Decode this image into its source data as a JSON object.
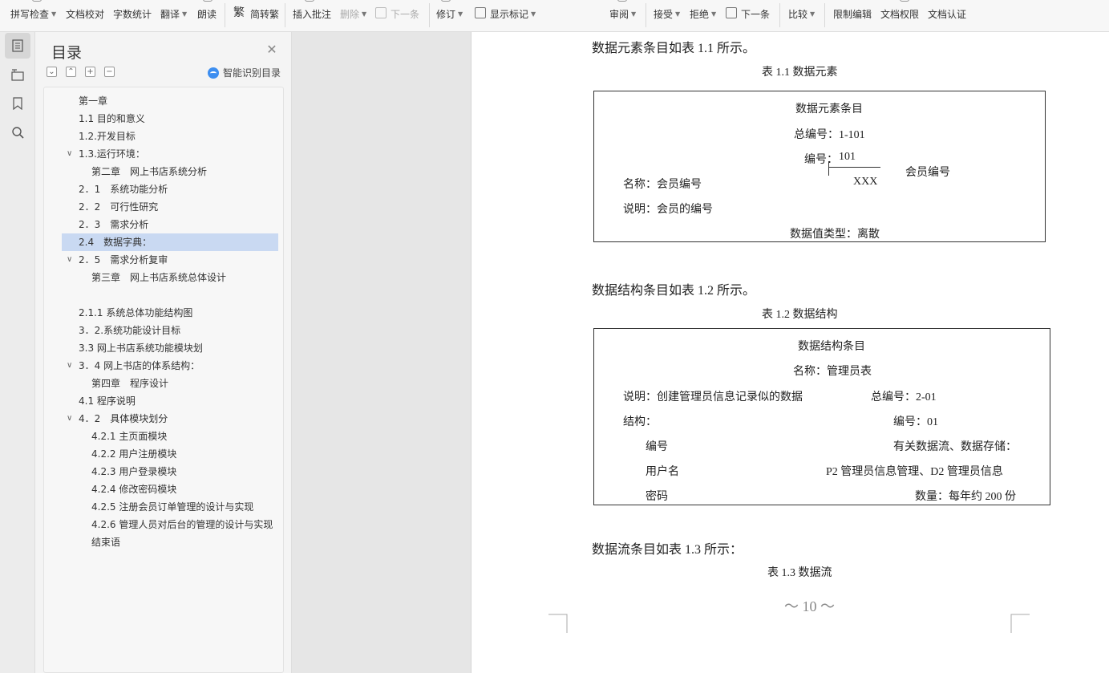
{
  "toolbar": {
    "spell_check": "拼写检查",
    "doc_proof": "文档校对",
    "word_count": "字数统计",
    "translate": "翻译",
    "read_aloud": "朗读",
    "trad_simp": "简转繁",
    "insert_comment": "插入批注",
    "delete": "删除",
    "next_item": "下一条",
    "revise": "修订",
    "show_markup": "显示标记",
    "review": "审阅",
    "accept": "接受",
    "reject": "拒绝",
    "next_change": "下一条",
    "compare": "比较",
    "restrict_edit": "限制编辑",
    "doc_permission": "文档权限",
    "doc_certify": "文档认证"
  },
  "toc": {
    "title": "目录",
    "smart_label": "智能识别目录",
    "items": [
      "第一章",
      "1.1 目的和意义",
      "1.2.开发目标",
      "1.3.运行环境：",
      "第二章　网上书店系统分析",
      "2．1　系统功能分析",
      "2．2　可行性研究",
      "2．3　需求分析",
      "2.4　数据字典：",
      "2．5　需求分析复审",
      "第三章　网上书店系统总体设计",
      "",
      "2.1.1  系统总体功能结构图",
      "3．2.系统功能设计目标",
      "3.3  网上书店系统功能模块划",
      "3．4  网上书店的体系结构：",
      "第四章　程序设计",
      "4.1 程序说明",
      "4．2　具体模块划分",
      "4.2.1 主页面模块",
      "4.2.2  用户注册模块",
      "4.2.3  用户登录模块",
      "4.2.4 修改密码模块",
      "4.2.5 注册会员订单管理的设计与实现",
      "4.2.6 管理人员对后台的管理的设计与实现",
      "结束语"
    ]
  },
  "doc": {
    "para1": "数据元素条目如表 1.1 所示。",
    "cap1": "表 1.1 数据元素",
    "t1": {
      "title": "数据元素条目",
      "total_no": "总编号：1-101",
      "no_label": "编号：",
      "no_value": "101",
      "name": "名称：会员编号",
      "xxx": "XXX",
      "alias": "会员编号",
      "desc": "说明：会员的编号",
      "type": "数据值类型：离散"
    },
    "para2": "数据结构条目如表 1.2 所示。",
    "cap2": "表 1.2 数据结构",
    "t2": {
      "title": "数据结构条目",
      "name": "名称：管理员表",
      "desc": "说明：创建管理员信息记录似的数据",
      "total_no": "总编号：2-01",
      "struct": "结构：",
      "no": "编号：01",
      "f1": "编号",
      "flow_label": "有关数据流、数据存储：",
      "f2": "用户名",
      "flow_value": "P2 管理员信息管理、D2 管理员信息",
      "f3": "密码",
      "quantity": "数量：每年约 200 份"
    },
    "para3": "数据流条目如表 1.3 所示：",
    "cap3": "表 1.3 数据流",
    "page_number": "～ 10 ～"
  },
  "colors": {
    "selection": "#c9d9f2",
    "accent": "#3d8ef0"
  }
}
